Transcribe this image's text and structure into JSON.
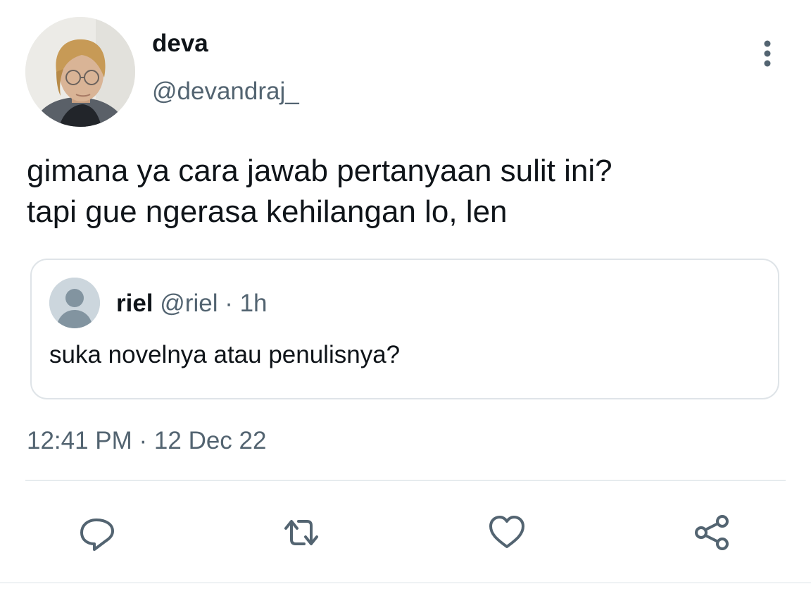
{
  "author": {
    "name": "deva",
    "handle": "@devandraj_"
  },
  "tweet": {
    "line1": "gimana ya cara jawab pertanyaan sulit ini?",
    "line2": "tapi gue ngerasa kehilangan lo, len",
    "timestamp": "12:41 PM · 12 Dec 22"
  },
  "quoted": {
    "name": "riel",
    "handle": "@riel",
    "separator": " · ",
    "time": "1h",
    "text": "suka novelnya atau penulisnya?"
  },
  "icons": {
    "more": "more-vertical-icon",
    "reply": "reply-icon",
    "retweet": "retweet-icon",
    "like": "heart-icon",
    "share": "share-icon"
  },
  "colors": {
    "text": "#0f1419",
    "secondary": "#536471",
    "border": "#dfe4e8"
  }
}
